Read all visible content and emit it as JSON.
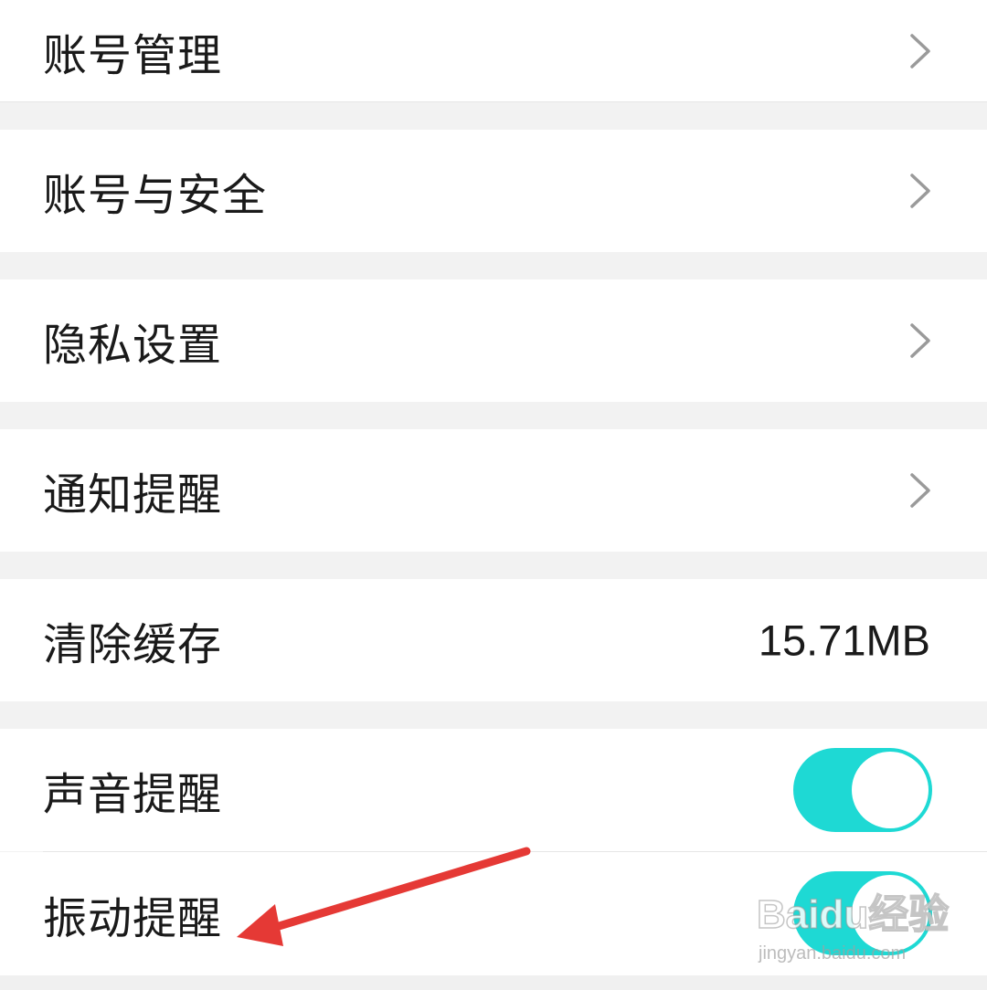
{
  "settings": {
    "items": [
      {
        "label": "账号管理",
        "type": "link"
      },
      {
        "label": "账号与安全",
        "type": "link"
      },
      {
        "label": "隐私设置",
        "type": "link"
      },
      {
        "label": "通知提醒",
        "type": "link"
      },
      {
        "label": "清除缓存",
        "type": "value",
        "value": "15.71MB"
      },
      {
        "label": "声音提醒",
        "type": "toggle",
        "on": true
      },
      {
        "label": "振动提醒",
        "type": "toggle",
        "on": true
      }
    ]
  },
  "icons": {
    "row_link": "chevron-right-icon",
    "annotation": "red-arrow"
  },
  "colors": {
    "toggle_on": "#1ed9d4",
    "annotation_arrow": "#e53935",
    "page_background": "#f2f2f2"
  },
  "watermark": {
    "logo": "Baidu经验",
    "url": "jingyan.baidu.com"
  }
}
